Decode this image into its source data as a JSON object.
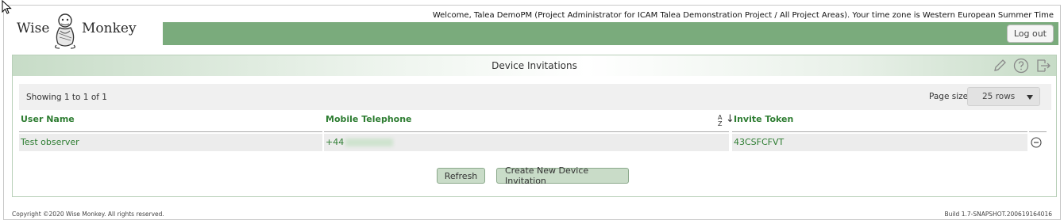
{
  "logo": {
    "left": "Wise",
    "right": "Monkey"
  },
  "header": {
    "welcome": "Welcome, Talea DemoPM (Project Administrator for ICAM Talea Demonstration Project / All Project Areas). Your time zone is Western European Summer Time",
    "logout_label": "Log out"
  },
  "panel": {
    "title": "Device Invitations",
    "icons": [
      "pencil-icon",
      "help-icon",
      "exit-icon"
    ]
  },
  "toolbar": {
    "showing": "Showing 1 to 1 of 1",
    "page_size_label": "Page size",
    "page_size_value": "25 rows"
  },
  "table": {
    "columns": [
      "User Name",
      "Mobile Telephone",
      "Invite Token"
    ],
    "sort_indicator": "A Z",
    "rows": [
      {
        "user_name": "Test observer",
        "mobile_prefix": "+44",
        "invite_token": "43CSFCFVT"
      }
    ]
  },
  "buttons": {
    "refresh": "Refresh",
    "create": "Create New Device Invitation"
  },
  "footer": {
    "copyright": "Copyright ©2020 Wise Monkey. All rights reserved.",
    "build": "Build 1.7-SNAPSHOT.200619164016"
  },
  "colors": {
    "accent_green": "#7aab7c",
    "link_green": "#2e7d32",
    "button_green": "#c9dcc8"
  }
}
